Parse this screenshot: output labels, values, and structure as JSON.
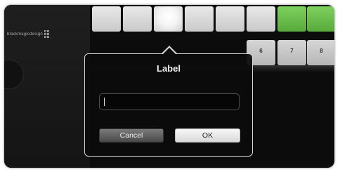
{
  "app": {
    "brand": "blackmagicdesign"
  },
  "grid": {
    "buttons": [
      {
        "name": "grid-button-r1c1",
        "style": "w",
        "label": ""
      },
      {
        "name": "grid-button-r1c2",
        "style": "w",
        "label": ""
      },
      {
        "name": "grid-button-r1c3",
        "style": "wl",
        "label": ""
      },
      {
        "name": "grid-button-r1c4",
        "style": "w",
        "label": ""
      },
      {
        "name": "grid-button-r1c5",
        "style": "w",
        "label": ""
      },
      {
        "name": "grid-button-r1c6",
        "style": "w",
        "label": ""
      },
      {
        "name": "grid-button-r1c7",
        "style": "g",
        "label": ""
      },
      {
        "name": "grid-button-r1c8",
        "style": "g",
        "label": ""
      },
      {
        "name": "grid-button-6",
        "style": "gr",
        "label": "6"
      },
      {
        "name": "grid-button-7",
        "style": "gr",
        "label": "7"
      },
      {
        "name": "grid-button-8",
        "style": "gr",
        "label": "8"
      }
    ]
  },
  "dialog": {
    "title": "Label",
    "field_value": "",
    "cancel_label": "Cancel",
    "ok_label": "OK"
  },
  "colors": {
    "background": "#0c0c0c",
    "active_green": "#6cc04a",
    "dialog_border": "#d4d4d4"
  }
}
